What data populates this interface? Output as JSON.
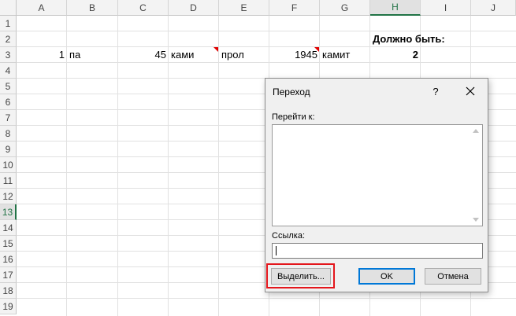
{
  "columns": [
    "A",
    "B",
    "C",
    "D",
    "E",
    "F",
    "G",
    "H",
    "I",
    "J"
  ],
  "selected_column": "H",
  "rows": [
    "1",
    "2",
    "3",
    "4",
    "5",
    "6",
    "7",
    "8",
    "9",
    "10",
    "11",
    "12",
    "13",
    "14",
    "15",
    "16",
    "17",
    "18",
    "19"
  ],
  "selected_row": "13",
  "cells": {
    "h2": "Должно быть:",
    "a3": "1",
    "b3": "па",
    "c3": "45",
    "d3": "ками",
    "e3": "прол",
    "f3": "1945",
    "g3": "камит",
    "h3": "2"
  },
  "comment_indicator_color": "#e00000",
  "dialog": {
    "title": "Переход",
    "help_label": "?",
    "goto_label": "Перейти к:",
    "goto_items": [],
    "reference_label": "Ссылка:",
    "reference_value": "",
    "special_button": "Выделить...",
    "ok_button": "OK",
    "cancel_button": "Отмена"
  },
  "highlight_color": "#e4161c",
  "accent_color": "#217346"
}
